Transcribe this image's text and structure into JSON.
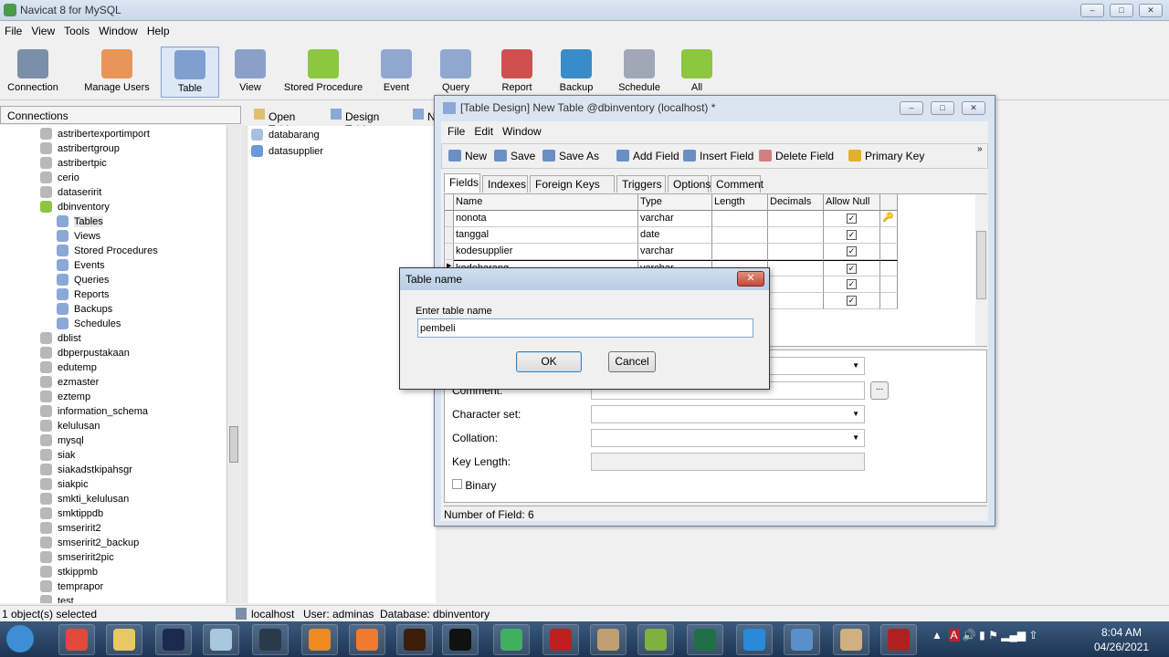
{
  "app": {
    "title": "Navicat 8 for MySQL"
  },
  "menu": [
    "File",
    "View",
    "Tools",
    "Window",
    "Help"
  ],
  "toolbar": [
    {
      "label": "Connection",
      "icon": "connection-icon",
      "color": "#7a8fa8"
    },
    {
      "label": "Manage Users",
      "icon": "user-icon",
      "color": "#e8955a"
    },
    {
      "label": "Table",
      "icon": "table-icon",
      "color": "#7f9fd0",
      "selected": true
    },
    {
      "label": "View",
      "icon": "view-icon",
      "color": "#8aa0c8"
    },
    {
      "label": "Stored Procedure",
      "icon": "stored-procedure-icon",
      "color": "#8dc63f"
    },
    {
      "label": "Event",
      "icon": "event-icon",
      "color": "#90a8d0"
    },
    {
      "label": "Query",
      "icon": "query-icon",
      "color": "#90a8d0"
    },
    {
      "label": "Report",
      "icon": "report-icon",
      "color": "#d05050"
    },
    {
      "label": "Backup",
      "icon": "backup-icon",
      "color": "#3a8cc8"
    },
    {
      "label": "Schedule",
      "icon": "schedule-icon",
      "color": "#a0a8b8"
    },
    {
      "label": "All",
      "icon": "all-icon",
      "color": "#8dc63f"
    }
  ],
  "connections": {
    "header": "Connections",
    "items": [
      {
        "label": "astribertexportimport",
        "level": 0
      },
      {
        "label": "astribertgroup",
        "level": 0
      },
      {
        "label": "astribertpic",
        "level": 0
      },
      {
        "label": "cerio",
        "level": 0
      },
      {
        "label": "dataseririt",
        "level": 0
      },
      {
        "label": "dbinventory",
        "level": 0,
        "open": true
      },
      {
        "label": "Tables",
        "level": 1,
        "selected": true
      },
      {
        "label": "Views",
        "level": 1
      },
      {
        "label": "Stored Procedures",
        "level": 1
      },
      {
        "label": "Events",
        "level": 1
      },
      {
        "label": "Queries",
        "level": 1
      },
      {
        "label": "Reports",
        "level": 1
      },
      {
        "label": "Backups",
        "level": 1
      },
      {
        "label": "Schedules",
        "level": 1
      },
      {
        "label": "dblist",
        "level": 0
      },
      {
        "label": "dbperpustakaan",
        "level": 0
      },
      {
        "label": "edutemp",
        "level": 0
      },
      {
        "label": "ezmaster",
        "level": 0
      },
      {
        "label": "eztemp",
        "level": 0
      },
      {
        "label": "information_schema",
        "level": 0
      },
      {
        "label": "kelulusan",
        "level": 0
      },
      {
        "label": "mysql",
        "level": 0
      },
      {
        "label": "siak",
        "level": 0
      },
      {
        "label": "siakadstkipahsgr",
        "level": 0
      },
      {
        "label": "siakpic",
        "level": 0
      },
      {
        "label": "smkti_kelulusan",
        "level": 0
      },
      {
        "label": "smktippdb",
        "level": 0
      },
      {
        "label": "smseririt2",
        "level": 0
      },
      {
        "label": "smseririt2_backup",
        "level": 0
      },
      {
        "label": "smseririt2pic",
        "level": 0
      },
      {
        "label": "stkippmb",
        "level": 0
      },
      {
        "label": "temprapor",
        "level": 0
      },
      {
        "label": "test",
        "level": 0
      }
    ]
  },
  "objects": {
    "toolbar": [
      "Open Table",
      "Design Table",
      "N"
    ],
    "items": [
      "databarang",
      "datasupplier"
    ]
  },
  "status": {
    "left": "1 object(s) selected",
    "host": "localhost",
    "user": "User: adminas",
    "database": "Database: dbinventory"
  },
  "design": {
    "title": "[Table Design] New Table @dbinventory (localhost) *",
    "menu": [
      "File",
      "Edit",
      "Window"
    ],
    "toolbar": [
      "New",
      "Save",
      "Save As",
      "Add Field",
      "Insert Field",
      "Delete Field",
      "Primary Key"
    ],
    "tabs": [
      "Fields",
      "Indexes",
      "Foreign Keys",
      "Triggers",
      "Options",
      "Comment"
    ],
    "columns": [
      "Name",
      "Type",
      "Length",
      "Decimals",
      "Allow Null"
    ],
    "rows": [
      {
        "name": "nonota",
        "type": "varchar",
        "allow_null": true,
        "primary_key": true
      },
      {
        "name": "tanggal",
        "type": "date",
        "allow_null": true
      },
      {
        "name": "kodesupplier",
        "type": "varchar",
        "allow_null": true
      },
      {
        "name": "kodebarang",
        "type": "varchar",
        "allow_null": true,
        "current": true
      },
      {
        "name": "",
        "type": "",
        "allow_null": true
      },
      {
        "name": "",
        "type": "",
        "allow_null": true
      }
    ],
    "props": {
      "comment": "Comment:",
      "charset": "Character set:",
      "collation": "Collation:",
      "key_length": "Key Length:",
      "binary": "Binary",
      "binary_checked": false
    },
    "status": "Number of Field: 6"
  },
  "dialog": {
    "title": "Table name",
    "label": "Enter table name",
    "value": "pembeli",
    "ok": "OK",
    "cancel": "Cancel"
  },
  "taskbar": {
    "apps": [
      {
        "icon": "windows-start-icon",
        "color": "#3c8fd6"
      },
      {
        "icon": "chrome-icon",
        "color": "#e04a3a"
      },
      {
        "icon": "file-explorer-icon",
        "color": "#e8c860"
      },
      {
        "icon": "photoshop-icon",
        "color": "#1b2a4e"
      },
      {
        "icon": "notepad-icon",
        "color": "#a8c8e0"
      },
      {
        "icon": "app-icon",
        "color": "#2a3a48"
      },
      {
        "icon": "uc-browser-icon",
        "color": "#f08a20"
      },
      {
        "icon": "screen-recorder-icon",
        "color": "#f07a30"
      },
      {
        "icon": "illustrator-icon",
        "color": "#3a1e0a"
      },
      {
        "icon": "cmd-icon",
        "color": "#111111"
      },
      {
        "icon": "navicat-icon",
        "color": "#40b060"
      },
      {
        "icon": "filezilla-icon",
        "color": "#bf1e1e"
      },
      {
        "icon": "app-icon",
        "color": "#c0a070"
      },
      {
        "icon": "notepad-plus-icon",
        "color": "#80b040"
      },
      {
        "icon": "excel-icon",
        "color": "#1e7145"
      },
      {
        "icon": "vscode-icon",
        "color": "#2a8ad8"
      },
      {
        "icon": "control-panel-icon",
        "color": "#5a90c8"
      },
      {
        "icon": "paint-icon",
        "color": "#d0b080"
      },
      {
        "icon": "app-icon",
        "color": "#b02020"
      }
    ],
    "time": "8:04 AM",
    "date": "04/26/2021"
  }
}
